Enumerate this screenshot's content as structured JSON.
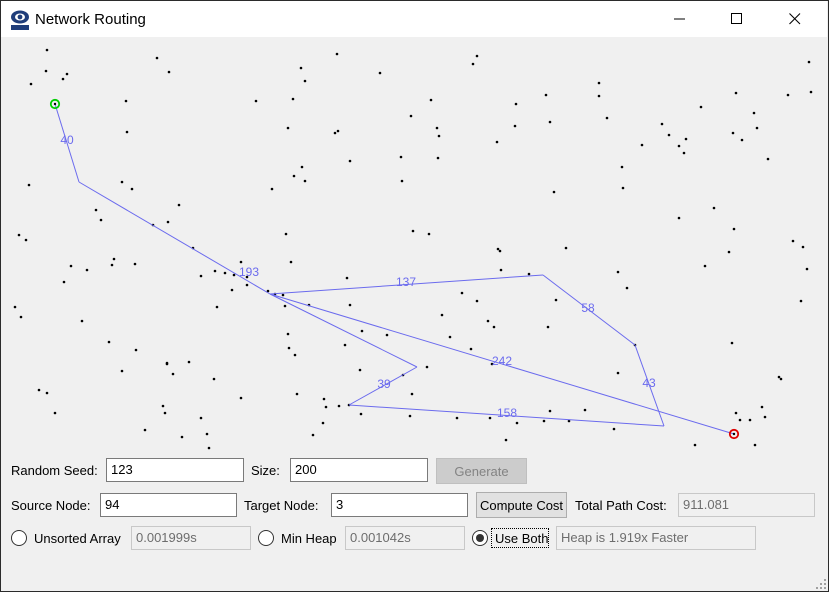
{
  "window": {
    "title": "Network Routing",
    "app_icon": "cs312-logo-icon",
    "controls": [
      "minimize-icon",
      "maximize-icon",
      "close-icon"
    ]
  },
  "graph": {
    "node_color": "#000000",
    "edge_color": "#6b6bee",
    "label_color": "#6b6bee",
    "source_marker_color": "#00cc00",
    "target_marker_color": "#dd0000",
    "edge_labels": [
      "40",
      "193",
      "137",
      "58",
      "242",
      "39",
      "43",
      "158"
    ]
  },
  "controls": {
    "random_seed_label": "Random Seed:",
    "random_seed_value": "123",
    "size_label": "Size:",
    "size_value": "200",
    "generate_label": "Generate",
    "source_node_label": "Source Node:",
    "source_node_value": "94",
    "target_node_label": "Target Node:",
    "target_node_value": "3",
    "compute_cost_label": "Compute Cost",
    "total_path_cost_label": "Total Path Cost:",
    "total_path_cost_value": "911.081",
    "unsorted_array_label": "Unsorted Array",
    "unsorted_array_time": "0.001999s",
    "min_heap_label": "Min Heap",
    "min_heap_time": "0.001042s",
    "use_both_label": "Use Both",
    "comparison_text": "Heap is 1.919x Faster",
    "selected_mode": "Use Both"
  }
}
